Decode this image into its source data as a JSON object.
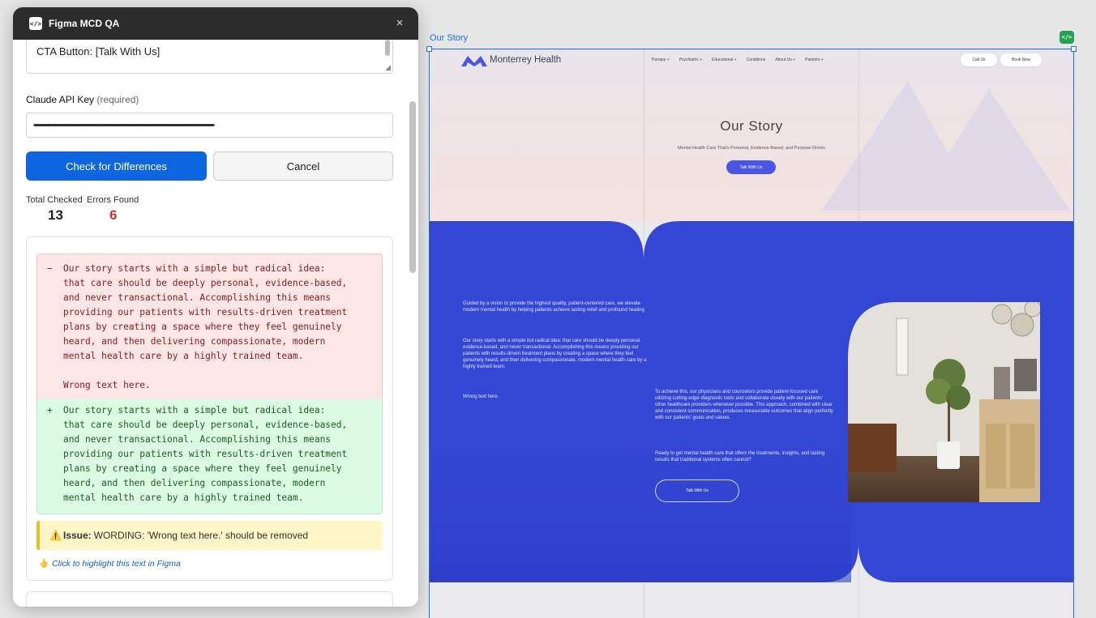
{
  "plugin": {
    "title": "Figma MCD QA",
    "close_icon": "×",
    "prompt_value": "CTA Button: [Talk With Us]",
    "api_key_label": "Claude API Key",
    "api_key_required": "(required)",
    "api_key_value": "••••••••••••••••••••••••••••••••••••••••••••••••••••••••••••••••••••••••••••••••••••••••••••••••••••••••••••••••••••••••",
    "check_button": "Check for Differences",
    "cancel_button": "Cancel",
    "stats": {
      "total_label": "Total Checked",
      "total_value": "13",
      "errors_label": "Errors Found",
      "errors_value": "6"
    },
    "result": {
      "removed_sign": "−",
      "removed_text": "Our story starts with a simple but radical idea:\nthat care should be deeply personal, evidence-based,\nand never transactional. Accomplishing this means\nproviding our patients with results-driven treatment\nplans by creating a space where they feel genuinely\nheard, and then delivering compassionate, modern\nmental health care by a highly trained team.\n\nWrong text here.",
      "added_sign": "+",
      "added_text": "Our story starts with a simple but radical idea:\nthat care should be deeply personal, evidence-based,\nand never transactional. Accomplishing this means\nproviding our patients with results-driven treatment\nplans by creating a space where they feel genuinely\nheard, and then delivering compassionate, modern\nmental health care by a highly trained team.",
      "issue_icon": "⚠️",
      "issue_label": "Issue:",
      "issue_text": "WORDING: 'Wrong text here.' should be removed",
      "hint_icon": "👆",
      "hint_text": "Click to highlight this text in Figma"
    }
  },
  "canvas": {
    "frame_label": "Our Story",
    "dev_badge": "</>",
    "site": {
      "logo_text": "Monterrey Health",
      "nav": [
        "Therapy +",
        "Psychiatric +",
        "Educational +",
        "Conditions",
        "About Us +",
        "Patients +"
      ],
      "call_us": "Call Us",
      "book_now": "Book Now",
      "hero_title": "Our Story",
      "hero_subtitle": "Mental Health Care That's Personal, Evidence-Based, and Purpose-Driven",
      "hero_cta": "Talk With Us",
      "para1": "Guided by a vision to provide the highest quality, patient-centered care, we elevate modern mental health by helping patients achieve lasting relief and profound healing",
      "para2": "Our story starts with a simple but radical idea: that care should be deeply personal, evidence-based, and never transactional. Accomplishing this means providing our patients with results-driven treatment plans by creating a space where they feel genuinely heard, and then delivering compassionate, modern mental health care by a highly trained team.",
      "para3": "Wrong text here.",
      "para4": "To achieve this, our physicians and counselors provide patient-focused care utilizing cutting-edge diagnostic tools and collaborate closely with our patients' other healthcare providers whenever possible. This approach, combined with clear and consistent communication, produces measurable outcomes that align perfectly with our patients' goals and values.",
      "para5": "Ready to get mental health care that offers the treatments, insights, and lasting results that traditional systems often cannot?",
      "blue_cta": "Talk With Us"
    }
  },
  "colors": {
    "primary_button": "#0d66e0",
    "figma_header": "#2c2c2c",
    "selection": "#1c6ee8",
    "site_blue": "#3447d4",
    "error": "#cc3333"
  }
}
